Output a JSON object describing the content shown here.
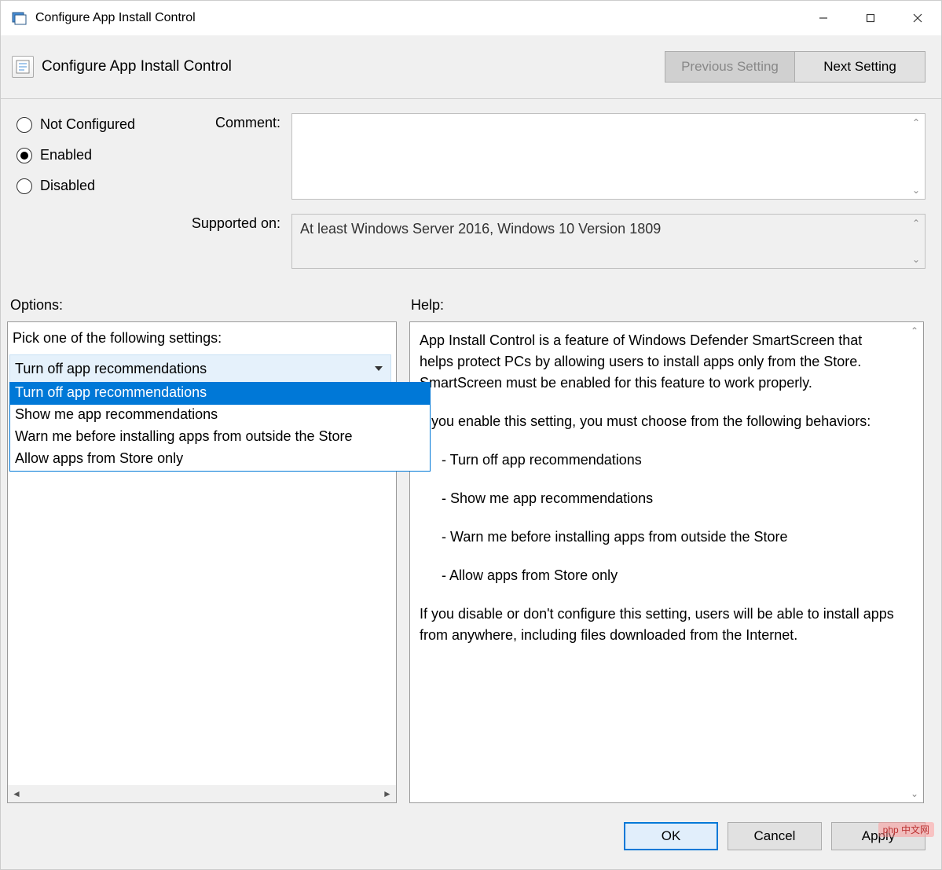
{
  "window": {
    "title": "Configure App Install Control"
  },
  "header": {
    "title": "Configure App Install Control",
    "prev": "Previous Setting",
    "next": "Next Setting"
  },
  "state": {
    "radios": {
      "not_configured": "Not Configured",
      "enabled": "Enabled",
      "disabled": "Disabled",
      "selected": "enabled"
    }
  },
  "fields": {
    "comment_label": "Comment:",
    "supported_label": "Supported on:",
    "supported_value": "At least Windows Server 2016, Windows 10 Version 1809"
  },
  "sections": {
    "options": "Options:",
    "help": "Help:"
  },
  "options": {
    "prompt": "Pick one of the following settings:",
    "selected": "Turn off app recommendations",
    "items": [
      "Turn off app recommendations",
      "Show me app recommendations",
      "Warn me before installing apps from outside the Store",
      "Allow apps from Store only"
    ]
  },
  "help": {
    "p1": "App Install Control is a feature of Windows Defender SmartScreen that helps protect PCs by allowing users to install apps only from the Store.  SmartScreen must be enabled for this feature to work properly.",
    "p2": "If you enable this setting, you must choose from the following behaviors:",
    "b1": "- Turn off app recommendations",
    "b2": "- Show me app recommendations",
    "b3": "- Warn me before installing apps from outside the Store",
    "b4": "- Allow apps from Store only",
    "p3": "If you disable or don't configure this setting, users will be able to install apps from anywhere, including files downloaded from the Internet."
  },
  "footer": {
    "ok": "OK",
    "cancel": "Cancel",
    "apply": "Apply"
  },
  "watermark": "php 中文网"
}
